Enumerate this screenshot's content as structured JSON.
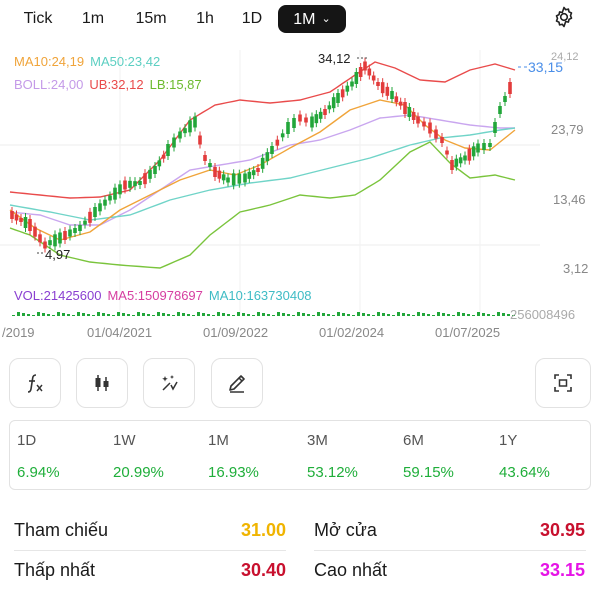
{
  "timeframes": [
    "Tick",
    "1m",
    "15m",
    "1h",
    "1D",
    "1M"
  ],
  "active_timeframe": "1M",
  "chart": {
    "indicators": {
      "ma10": "MA10:24,19",
      "ma50": "MA50:23,42",
      "boll": "BOLL:24,00",
      "ub": "UB:32,12",
      "lb": "LB:15,87"
    },
    "price_axis": [
      "24,12",
      "23,79",
      "13,46",
      "3,12"
    ],
    "current_price": "33,15",
    "high_marker": "34,12",
    "low_marker": "4,97",
    "volume": {
      "vol": "VOL:21425600",
      "ma5": "MA5:150978697",
      "ma10": "MA10:163730408",
      "axis": "256008496"
    },
    "dates": [
      "/2019",
      "01/04/2021",
      "01/09/2022",
      "01/02/2024",
      "01/07/2025"
    ],
    "colors": {
      "up": "#22a63a",
      "down": "#e23b3b",
      "ma10": "#f0a43a",
      "ma50": "#70d4c8",
      "boll": "#c9a6ef",
      "ub": "#e94b4b",
      "lb": "#7ac43c",
      "price_line": "#4a8ee8"
    }
  },
  "tools": [
    {
      "name": "indicator",
      "icon": "function-icon"
    },
    {
      "name": "chart-type",
      "icon": "candlestick-icon"
    },
    {
      "name": "magic",
      "icon": "magic-wand-icon"
    },
    {
      "name": "draw",
      "icon": "pencil-icon"
    },
    {
      "name": "fullscreen",
      "icon": "fullscreen-icon"
    }
  ],
  "periods": [
    {
      "label": "1D",
      "value": "6.94%"
    },
    {
      "label": "1W",
      "value": "20.99%"
    },
    {
      "label": "1M",
      "value": "16.93%"
    },
    {
      "label": "3M",
      "value": "53.12%"
    },
    {
      "label": "6M",
      "value": "59.15%"
    },
    {
      "label": "1Y",
      "value": "43.64%"
    }
  ],
  "stats": {
    "ref_label": "Tham chiếu",
    "ref_value": "31.00",
    "open_label": "Mở cửa",
    "open_value": "30.95",
    "low_label": "Thấp nhất",
    "low_value": "30.40",
    "high_label": "Cao nhất",
    "high_value": "33.15",
    "ref_color": "#f0b400",
    "open_color": "#c8102e",
    "low_color": "#c8102e",
    "high_color": "#e614e6"
  }
}
